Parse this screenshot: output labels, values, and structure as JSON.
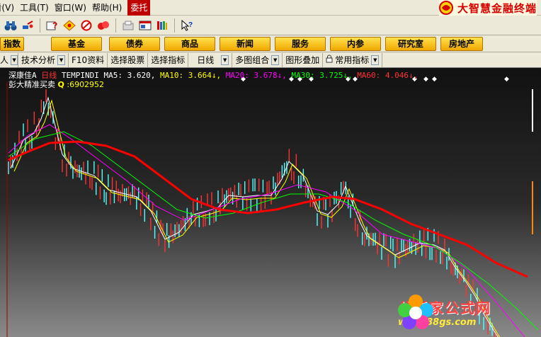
{
  "menubar": {
    "items": [
      {
        "label": "查看(V)"
      },
      {
        "label": "工具(T)"
      },
      {
        "label": "窗口(W)"
      },
      {
        "label": "帮助(H)"
      }
    ],
    "active_label": "委托",
    "brand": "大智慧金融终端"
  },
  "toolbar": {
    "icons": [
      "binoculars-icon",
      "satellite-icon",
      "question-icon",
      "diamond-icon",
      "no-entry-icon",
      "coins-icon",
      "paper-icon",
      "window-icon",
      "books-icon",
      "help-cursor-icon"
    ]
  },
  "navbar": {
    "items": [
      "指数",
      "基金",
      "债券",
      "商品",
      "新闻",
      "服务",
      "内参",
      "研究室",
      "房地产"
    ]
  },
  "tabbar": {
    "items": [
      {
        "label": "人",
        "dropdown": true
      },
      {
        "label": "技术分析",
        "dropdown": true
      },
      {
        "label": "F10资料",
        "dropdown": false
      },
      {
        "label": "选择股票",
        "dropdown": false
      },
      {
        "label": "选择指标",
        "dropdown": false
      },
      {
        "label": "日线",
        "dropdown": true
      },
      {
        "label": "多图组合",
        "dropdown": true
      },
      {
        "label": "图形叠加",
        "dropdown": false
      },
      {
        "label": "常用指标",
        "dropdown": true
      }
    ]
  },
  "chart": {
    "stock_name": "深康佳A",
    "period": "日线",
    "indicator": "TEMPINDI",
    "ma5_label": "MA5:",
    "ma5_value": "3.620,",
    "ma10_label": "MA10:",
    "ma10_value": "3.664↓,",
    "ma20_label": "MA20:",
    "ma20_value": "3.678↓,",
    "ma30_label": "MA30:",
    "ma30_value": "3.725↓,",
    "ma60_label": "MA60:",
    "ma60_value": "4.046↓,",
    "line2_label": "彭大精准买卖",
    "line2_q": "Q",
    "line2_value": ":6902952",
    "colors": {
      "ma5": "#ffffff",
      "ma10": "#ffff00",
      "ma20": "#ff00ff",
      "ma30": "#00ff00",
      "ma60": "#ff0000",
      "up": "#ff3232",
      "down": "#54ffff"
    }
  },
  "watermark": {
    "title": "分析家公式网",
    "url": "www.88gs.com"
  }
}
